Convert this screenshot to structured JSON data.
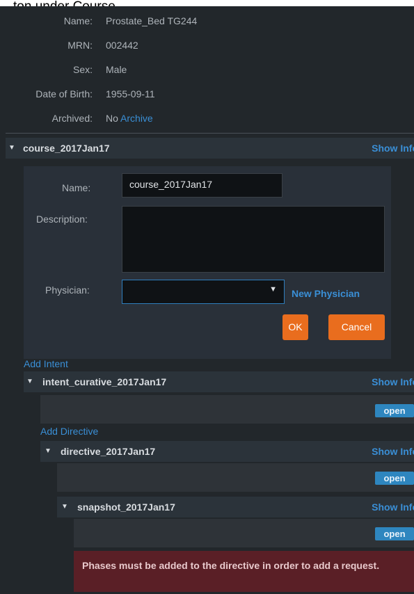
{
  "caption": "…ton under Course",
  "patient": {
    "rows": [
      {
        "label": "Name:",
        "value": "Prostate_Bed TG244"
      },
      {
        "label": "MRN:",
        "value": "002442"
      },
      {
        "label": "Sex:",
        "value": "Male"
      },
      {
        "label": "Date of Birth:",
        "value": "1955-09-11"
      },
      {
        "label": "Archived:",
        "value": "No"
      }
    ],
    "archive_link": "Archive"
  },
  "show_info_label": "Show Info",
  "course": {
    "title": "course_2017Jan17",
    "form": {
      "name_label": "Name:",
      "name_value": "course_2017Jan17",
      "description_label": "Description:",
      "description_value": "",
      "physician_label": "Physician:",
      "physician_value": "",
      "new_physician_link": "New Physician",
      "ok_label": "OK",
      "cancel_label": "Cancel"
    },
    "add_intent_link": "Add Intent"
  },
  "intent": {
    "title": "intent_curative_2017Jan17",
    "open_label": "open",
    "add_directive_link": "Add Directive"
  },
  "directive": {
    "title": "directive_2017Jan17",
    "open_label": "open"
  },
  "snapshot": {
    "title": "snapshot_2017Jan17",
    "open_label": "open",
    "alert": "Phases must be added to the directive in order to add a request."
  },
  "colors": {
    "panel_bg": "#22272b",
    "header_bg": "#2b333a",
    "link": "#3a8fd6",
    "primary_button": "#e96d1e",
    "open_button": "#2e86bf",
    "alert_bg": "#5a1f26"
  }
}
